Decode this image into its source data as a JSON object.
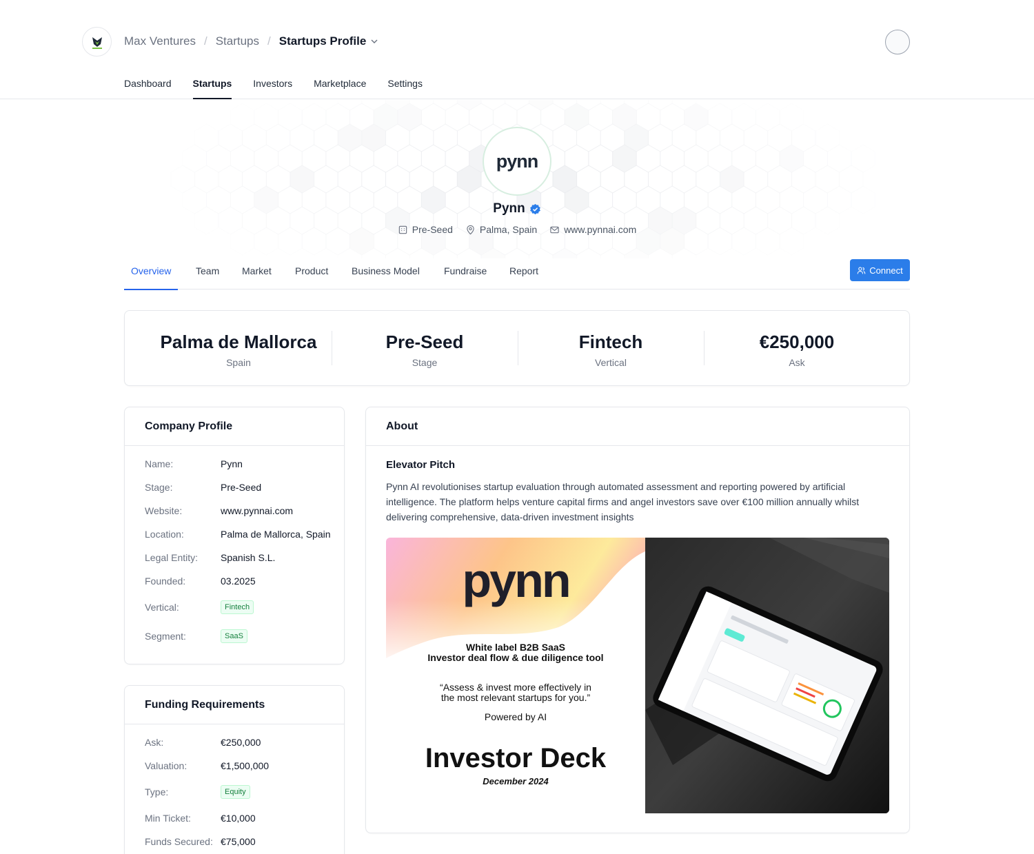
{
  "breadcrumb": {
    "org": "Max Ventures",
    "section": "Startups",
    "current": "Startups Profile"
  },
  "main_nav": [
    "Dashboard",
    "Startups",
    "Investors",
    "Marketplace",
    "Settings"
  ],
  "main_nav_active": "Startups",
  "startup": {
    "logo_text": "pynn",
    "name": "Pynn",
    "verified": true,
    "stage": "Pre-Seed",
    "location": "Palma, Spain",
    "website": "www.pynnai.com"
  },
  "tabs": [
    "Overview",
    "Team",
    "Market",
    "Product",
    "Business Model",
    "Fundraise",
    "Report"
  ],
  "tab_active": "Overview",
  "connect_label": "Connect",
  "stats": [
    {
      "value": "Palma de Mallorca",
      "label": "Spain"
    },
    {
      "value": "Pre-Seed",
      "label": "Stage"
    },
    {
      "value": "Fintech",
      "label": "Vertical"
    },
    {
      "value": "€250,000",
      "label": "Ask"
    }
  ],
  "company_profile": {
    "title": "Company Profile",
    "rows": [
      {
        "key": "Name:",
        "value": "Pynn"
      },
      {
        "key": "Stage:",
        "value": "Pre-Seed"
      },
      {
        "key": "Website:",
        "value": "www.pynnai.com"
      },
      {
        "key": "Location:",
        "value": "Palma de Mallorca, Spain"
      },
      {
        "key": "Legal Entity:",
        "value": "Spanish S.L."
      },
      {
        "key": "Founded:",
        "value": "03.2025"
      },
      {
        "key": "Vertical:",
        "badge": "Fintech"
      },
      {
        "key": "Segment:",
        "badge": "SaaS"
      }
    ]
  },
  "funding": {
    "title": "Funding Requirements",
    "rows": [
      {
        "key": "Ask:",
        "value": "€250,000"
      },
      {
        "key": "Valuation:",
        "value": "€1,500,000"
      },
      {
        "key": "Type:",
        "badge": "Equity"
      },
      {
        "key": "Min Ticket:",
        "value": "€10,000"
      },
      {
        "key": "Funds Secured:",
        "value": "€75,000"
      }
    ]
  },
  "about": {
    "title": "About",
    "pitch_title": "Elevator Pitch",
    "pitch_text": "Pynn AI revolutionises startup evaluation through automated assessment and reporting powered by artificial intelligence. The platform helps venture capital firms and angel investors save over €100 million annually whilst delivering comprehensive, data-driven investment insights"
  },
  "deck": {
    "logo": "pynn",
    "tagline_1": "White label B2B SaaS",
    "tagline_2": "Investor deal flow & due diligence tool",
    "quote_1": "“Assess & invest more effectively in",
    "quote_2": "the most relevant startups for you.”",
    "powered": "Powered by AI",
    "title": "Investor Deck",
    "date": "December 2024"
  },
  "colors": {
    "accent": "#2b7de9",
    "badge_green": "#15803d",
    "text_dark": "#111827"
  }
}
